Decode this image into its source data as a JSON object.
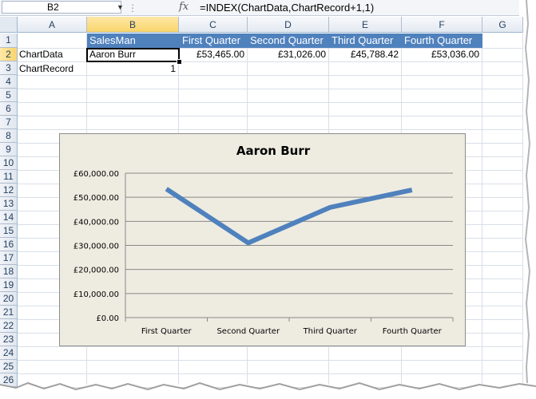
{
  "formula_bar": {
    "name_box": "B2",
    "fx_icon": "fx",
    "formula": "=INDEX(ChartData,ChartRecord+1,1)"
  },
  "columns": [
    "A",
    "B",
    "C",
    "D",
    "E",
    "F",
    "G"
  ],
  "rows": [
    "1",
    "2",
    "3",
    "4",
    "5",
    "6",
    "7",
    "8",
    "9",
    "10",
    "11",
    "12",
    "13",
    "14",
    "15",
    "16",
    "17",
    "18",
    "19",
    "20",
    "21",
    "22",
    "23",
    "24",
    "25",
    "26"
  ],
  "header_row": {
    "salesman": "SalesMan",
    "q1": "First Quarter",
    "q2": "Second Quarter",
    "q3": "Third Quarter",
    "q4": "Fourth Quarter"
  },
  "data_row": {
    "label": "ChartData",
    "name": "Aaron Burr",
    "q1": "£53,465.00",
    "q2": "£31,026.00",
    "q3": "£45,788.42",
    "q4": "£53,036.00"
  },
  "record_row": {
    "label": "ChartRecord",
    "value": "1"
  },
  "colors": {
    "header_fill": "#4f81bd",
    "series_line": "#4f81bd",
    "chart_bg": "#eeece1",
    "selection": "#f8d46b"
  },
  "chart_data": {
    "type": "line",
    "title": "Aaron Burr",
    "categories": [
      "First Quarter",
      "Second Quarter",
      "Third Quarter",
      "Fourth Quarter"
    ],
    "values": [
      53465.0,
      31026.0,
      45788.42,
      53036.0
    ],
    "ylim": [
      0,
      60000
    ],
    "yticks": [
      "£0.00",
      "£10,000.00",
      "£20,000.00",
      "£30,000.00",
      "£40,000.00",
      "£50,000.00",
      "£60,000.00"
    ],
    "grid": true,
    "legend": "none"
  }
}
